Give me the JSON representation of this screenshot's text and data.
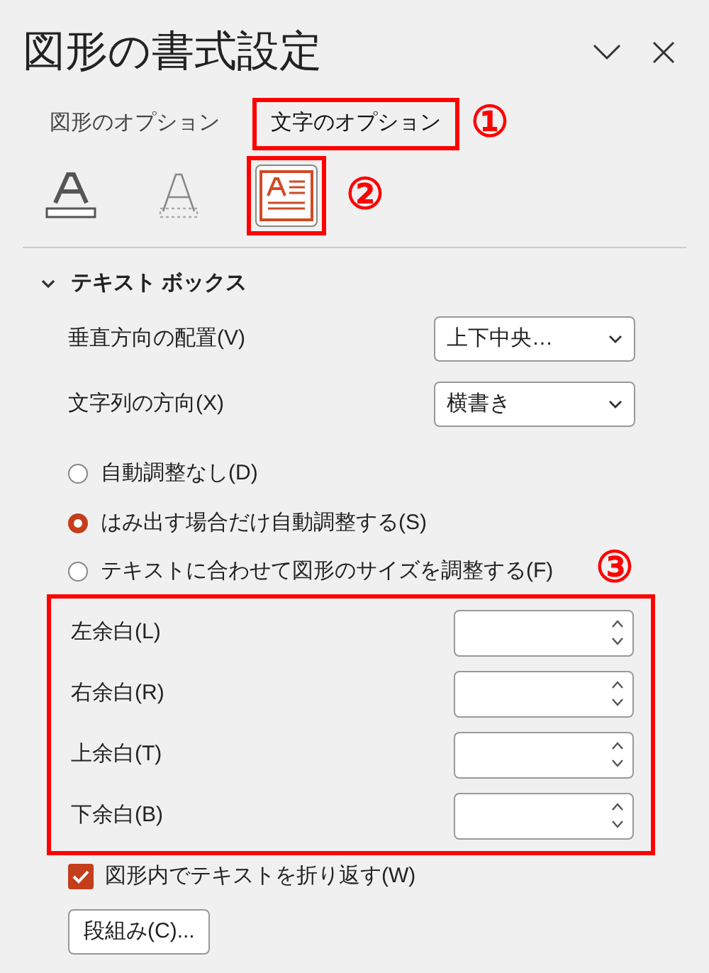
{
  "panel": {
    "title": "図形の書式設定"
  },
  "tabs": [
    {
      "label": "図形のオプション",
      "selected": false,
      "highlighted": false
    },
    {
      "label": "文字のオプション",
      "selected": true,
      "highlighted": true,
      "annotation": "①"
    }
  ],
  "icon_tabs": [
    {
      "kind": "fill",
      "selected": false,
      "highlighted": false
    },
    {
      "kind": "outline",
      "selected": false,
      "highlighted": false
    },
    {
      "kind": "textbox",
      "selected": true,
      "highlighted": true,
      "annotation": "②"
    }
  ],
  "section": {
    "title": "テキスト ボックス",
    "expanded": true
  },
  "dropdowns": [
    {
      "label": "垂直方向の配置(V)",
      "value": "上下中央…"
    },
    {
      "label": "文字列の方向(X)",
      "value": "横書き"
    }
  ],
  "autofit": [
    {
      "label": "自動調整なし(D)",
      "selected": false
    },
    {
      "label": "はみ出す場合だけ自動調整する(S)",
      "selected": true
    },
    {
      "label": "テキストに合わせて図形のサイズを調整する(F)",
      "selected": false
    }
  ],
  "margins": {
    "highlighted": true,
    "annotation": "③",
    "fields": [
      {
        "label": "左余白(L)"
      },
      {
        "label": "右余白(R)"
      },
      {
        "label": "上余白(T)"
      },
      {
        "label": "下余白(B)"
      }
    ]
  },
  "wrap": {
    "label": "図形内でテキストを折り返す(W)",
    "checked": true
  },
  "columns_button": "段組み(C)..."
}
